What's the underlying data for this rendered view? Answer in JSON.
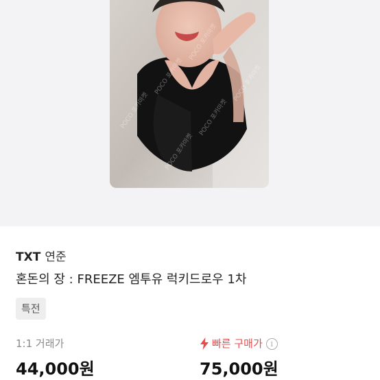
{
  "product": {
    "artist": "TXT",
    "member": "연준",
    "title": "혼돈의 장 : FREEZE 엠투유 럭키드로우 1차",
    "tag": "특전"
  },
  "prices": {
    "trade_label": "1:1 거래가",
    "trade_price": "44,000원",
    "fast_label": "빠른 구매가",
    "fast_price": "75,000원"
  },
  "icons": {
    "fast": "lightning-bolt-icon",
    "info": "info-circle-icon"
  },
  "colors": {
    "fast_accent": "#e84b4b",
    "photo_background": "#f3f3f5",
    "tag_background": "#eeeeef"
  }
}
